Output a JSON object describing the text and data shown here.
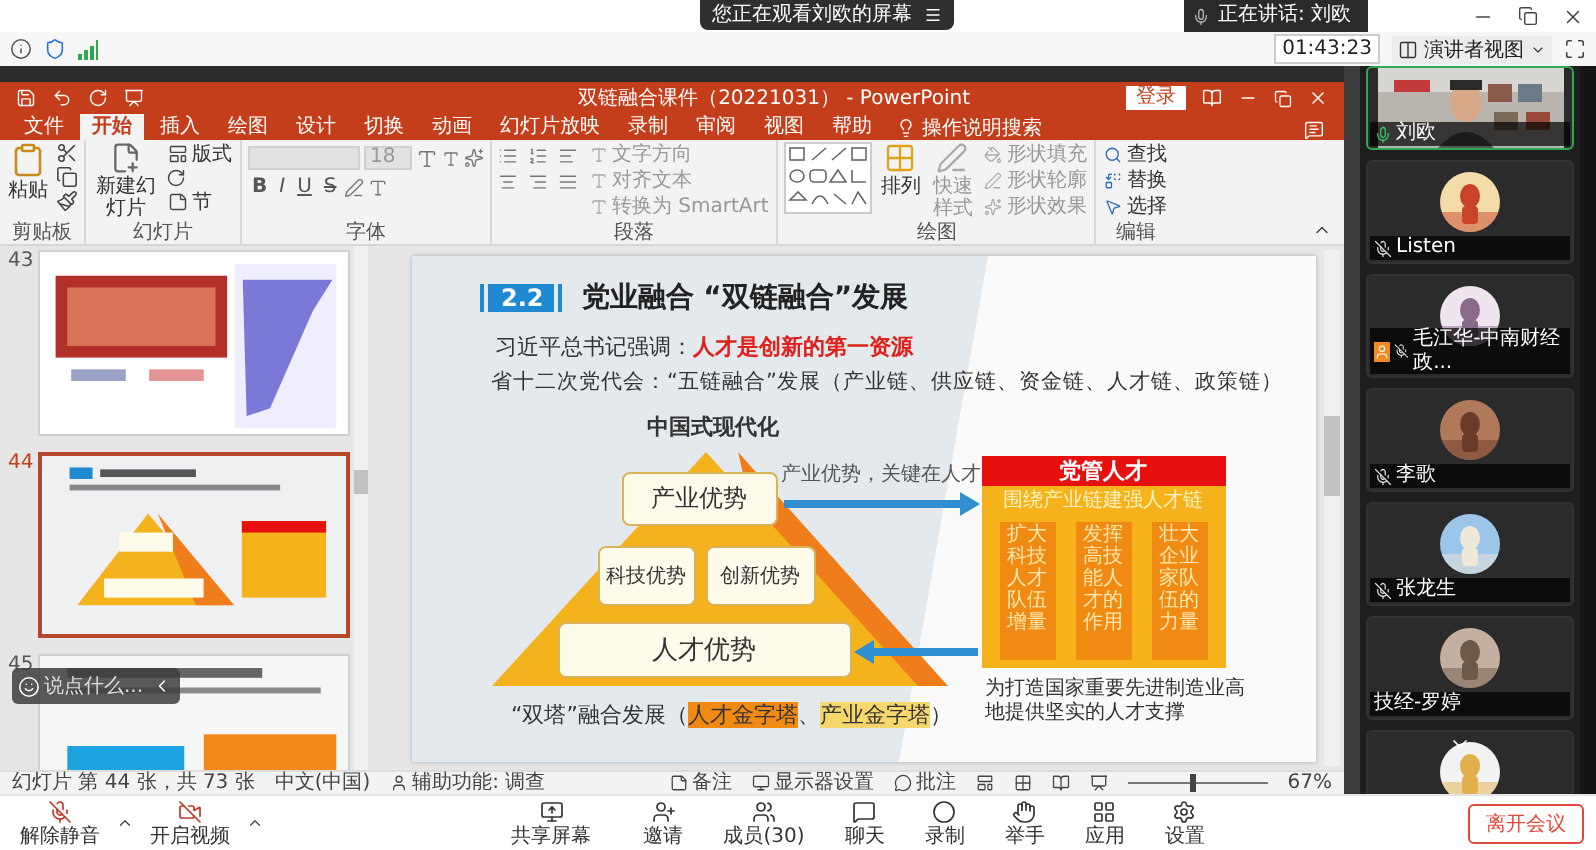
{
  "meeting": {
    "viewing_banner": "您正在观看刘欧的屏幕",
    "speaking_label": "正在讲话: 刘欧",
    "timer": "01:43:23",
    "view_mode": "演讲者视图"
  },
  "powerpoint": {
    "title": "双链融合课件（20221031） - PowerPoint",
    "sign_in": "登录",
    "tabs": [
      {
        "label": "文件",
        "selected": false
      },
      {
        "label": "开始",
        "selected": true
      },
      {
        "label": "插入",
        "selected": false
      },
      {
        "label": "绘图",
        "selected": false
      },
      {
        "label": "设计",
        "selected": false
      },
      {
        "label": "切换",
        "selected": false
      },
      {
        "label": "动画",
        "selected": false
      },
      {
        "label": "幻灯片放映",
        "selected": false
      },
      {
        "label": "录制",
        "selected": false
      },
      {
        "label": "审阅",
        "selected": false
      },
      {
        "label": "视图",
        "selected": false
      },
      {
        "label": "帮助",
        "selected": false
      }
    ],
    "tell_me": "操作说明搜索",
    "ribbon": {
      "clipboard": {
        "label": "剪贴板",
        "paste": "粘贴"
      },
      "slides": {
        "label": "幻灯片",
        "new_slide": "新建幻灯片",
        "layout": "版式",
        "section": "节"
      },
      "font": {
        "label": "字体",
        "size": "18",
        "styles": [
          "B",
          "I",
          "U",
          "S"
        ]
      },
      "paragraph": {
        "label": "段落",
        "commands": [
          "文字方向",
          "对齐文本",
          "转换为 SmartArt"
        ]
      },
      "drawing": {
        "label": "绘图",
        "arrange": "排列",
        "quick_styles": "快速样式",
        "commands": [
          "形状填充",
          "形状轮廓",
          "形状效果"
        ]
      },
      "editing": {
        "label": "编辑",
        "commands": [
          "查找",
          "替换",
          "选择"
        ]
      }
    },
    "thumbnails": [
      {
        "number": "43",
        "selected": false
      },
      {
        "number": "44",
        "selected": true
      },
      {
        "number": "45",
        "selected": false
      }
    ],
    "slide": {
      "section_number": "2.2",
      "title": "党业融合 “双链融合”发展",
      "lead": "习近平总书记强调：",
      "highlight": "人才是创新的第一资源",
      "policy": "省十二次党代会：“五链融合”发展（产业链、供应链、资金链、人才链、政策链）",
      "pyramid_title": "中国式现代化",
      "advantages": [
        "产业优势",
        "科技优势",
        "创新优势",
        "人才优势"
      ],
      "arrow_label": "产业优势，关键在人才",
      "talent_box": {
        "header": "党管人才",
        "subheader": "围绕产业链建强人才链",
        "columns": [
          "扩大科技人才队伍增量",
          "发挥高技能人才的作用",
          "壮大企业家队伍的力量"
        ]
      },
      "caption": "为打造国家重要先进制造业高地提供坚实的人才支撑",
      "towers": {
        "prefix": "“双塔”融合发展（",
        "first": "人才金字塔",
        "separator": "、",
        "second": "产业金字塔",
        "suffix": "）"
      }
    },
    "status_bar": {
      "slide_position": "幻灯片 第 44 张，共 73 张",
      "language": "中文(中国)",
      "accessibility": "辅助功能: 调查",
      "notes": "备注",
      "display_settings": "显示器设置",
      "comments": "批注",
      "zoom": {
        "level": 0.45,
        "reading": "67%"
      }
    }
  },
  "chat_box": {
    "placeholder": "说点什么..."
  },
  "participants": [
    {
      "name": "刘欧",
      "muted": false,
      "speaking": true,
      "video": true,
      "host": false
    },
    {
      "name": "Listen",
      "muted": true,
      "speaking": false,
      "video": false,
      "host": false
    },
    {
      "name": "毛江华-中南财经政...",
      "muted": true,
      "speaking": false,
      "video": false,
      "host": true
    },
    {
      "name": "李歌",
      "muted": true,
      "speaking": false,
      "video": false,
      "host": false
    },
    {
      "name": "张龙生",
      "muted": true,
      "speaking": false,
      "video": false,
      "host": false
    },
    {
      "name": "技经-罗婷",
      "muted": false,
      "speaking": false,
      "video": false,
      "host": false
    },
    {
      "muted": false,
      "speaking": false,
      "video": false,
      "host": false
    }
  ],
  "toolbar": {
    "left": [
      "解除静音",
      "开启视频"
    ],
    "center": [
      "共享屏幕",
      "邀请",
      "成员(30)",
      "聊天",
      "录制",
      "举手",
      "应用",
      "设置"
    ],
    "leave": "离开会议"
  }
}
